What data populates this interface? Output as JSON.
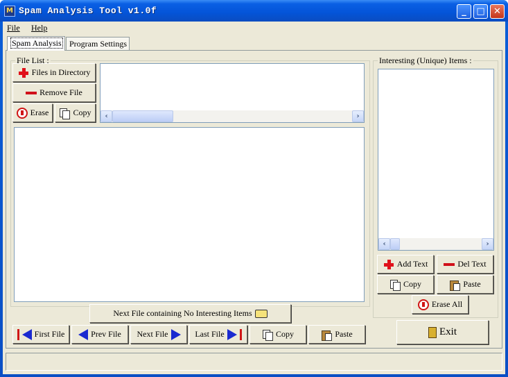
{
  "window": {
    "title": "Spam Analysis Tool v1.0f",
    "icon": "app-icon"
  },
  "titlebar_buttons": [
    "minimize",
    "maximize",
    "close"
  ],
  "menu": {
    "file": "File",
    "help": "Help"
  },
  "tabs": [
    {
      "label": "Spam Analysis",
      "active": true
    },
    {
      "label": "Program Settings",
      "active": false
    }
  ],
  "file_list": {
    "legend": "File List :",
    "files_in_directory": "Files in Directory",
    "remove_file": "Remove File",
    "erase": "Erase",
    "copy": "Copy"
  },
  "navigation": {
    "next_no_interesting": "Next File containing No Interesting Items",
    "first_file": "First File",
    "prev_file": "Prev File",
    "next_file": "Next File",
    "last_file": "Last File",
    "copy": "Copy",
    "paste": "Paste"
  },
  "interesting": {
    "legend": "Interesting (Unique) Items :",
    "add_text": "Add Text",
    "del_text": "Del Text",
    "copy": "Copy",
    "paste": "Paste",
    "erase_all": "Erase All"
  },
  "exit_label": "Exit",
  "status_text": ""
}
